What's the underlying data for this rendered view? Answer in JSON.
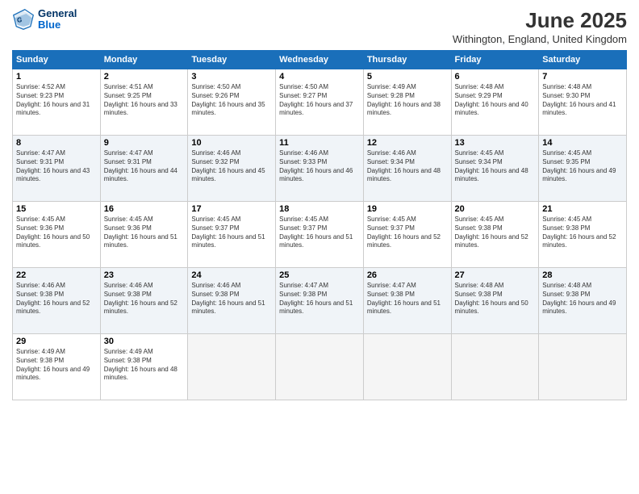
{
  "header": {
    "logo_line1": "General",
    "logo_line2": "Blue",
    "title": "June 2025",
    "subtitle": "Withington, England, United Kingdom"
  },
  "days_of_week": [
    "Sunday",
    "Monday",
    "Tuesday",
    "Wednesday",
    "Thursday",
    "Friday",
    "Saturday"
  ],
  "weeks": [
    [
      {
        "day": 1,
        "sunrise": "Sunrise: 4:52 AM",
        "sunset": "Sunset: 9:23 PM",
        "daylight": "Daylight: 16 hours and 31 minutes."
      },
      {
        "day": 2,
        "sunrise": "Sunrise: 4:51 AM",
        "sunset": "Sunset: 9:25 PM",
        "daylight": "Daylight: 16 hours and 33 minutes."
      },
      {
        "day": 3,
        "sunrise": "Sunrise: 4:50 AM",
        "sunset": "Sunset: 9:26 PM",
        "daylight": "Daylight: 16 hours and 35 minutes."
      },
      {
        "day": 4,
        "sunrise": "Sunrise: 4:50 AM",
        "sunset": "Sunset: 9:27 PM",
        "daylight": "Daylight: 16 hours and 37 minutes."
      },
      {
        "day": 5,
        "sunrise": "Sunrise: 4:49 AM",
        "sunset": "Sunset: 9:28 PM",
        "daylight": "Daylight: 16 hours and 38 minutes."
      },
      {
        "day": 6,
        "sunrise": "Sunrise: 4:48 AM",
        "sunset": "Sunset: 9:29 PM",
        "daylight": "Daylight: 16 hours and 40 minutes."
      },
      {
        "day": 7,
        "sunrise": "Sunrise: 4:48 AM",
        "sunset": "Sunset: 9:30 PM",
        "daylight": "Daylight: 16 hours and 41 minutes."
      }
    ],
    [
      {
        "day": 8,
        "sunrise": "Sunrise: 4:47 AM",
        "sunset": "Sunset: 9:31 PM",
        "daylight": "Daylight: 16 hours and 43 minutes."
      },
      {
        "day": 9,
        "sunrise": "Sunrise: 4:47 AM",
        "sunset": "Sunset: 9:31 PM",
        "daylight": "Daylight: 16 hours and 44 minutes."
      },
      {
        "day": 10,
        "sunrise": "Sunrise: 4:46 AM",
        "sunset": "Sunset: 9:32 PM",
        "daylight": "Daylight: 16 hours and 45 minutes."
      },
      {
        "day": 11,
        "sunrise": "Sunrise: 4:46 AM",
        "sunset": "Sunset: 9:33 PM",
        "daylight": "Daylight: 16 hours and 46 minutes."
      },
      {
        "day": 12,
        "sunrise": "Sunrise: 4:46 AM",
        "sunset": "Sunset: 9:34 PM",
        "daylight": "Daylight: 16 hours and 48 minutes."
      },
      {
        "day": 13,
        "sunrise": "Sunrise: 4:45 AM",
        "sunset": "Sunset: 9:34 PM",
        "daylight": "Daylight: 16 hours and 48 minutes."
      },
      {
        "day": 14,
        "sunrise": "Sunrise: 4:45 AM",
        "sunset": "Sunset: 9:35 PM",
        "daylight": "Daylight: 16 hours and 49 minutes."
      }
    ],
    [
      {
        "day": 15,
        "sunrise": "Sunrise: 4:45 AM",
        "sunset": "Sunset: 9:36 PM",
        "daylight": "Daylight: 16 hours and 50 minutes."
      },
      {
        "day": 16,
        "sunrise": "Sunrise: 4:45 AM",
        "sunset": "Sunset: 9:36 PM",
        "daylight": "Daylight: 16 hours and 51 minutes."
      },
      {
        "day": 17,
        "sunrise": "Sunrise: 4:45 AM",
        "sunset": "Sunset: 9:37 PM",
        "daylight": "Daylight: 16 hours and 51 minutes."
      },
      {
        "day": 18,
        "sunrise": "Sunrise: 4:45 AM",
        "sunset": "Sunset: 9:37 PM",
        "daylight": "Daylight: 16 hours and 51 minutes."
      },
      {
        "day": 19,
        "sunrise": "Sunrise: 4:45 AM",
        "sunset": "Sunset: 9:37 PM",
        "daylight": "Daylight: 16 hours and 52 minutes."
      },
      {
        "day": 20,
        "sunrise": "Sunrise: 4:45 AM",
        "sunset": "Sunset: 9:38 PM",
        "daylight": "Daylight: 16 hours and 52 minutes."
      },
      {
        "day": 21,
        "sunrise": "Sunrise: 4:45 AM",
        "sunset": "Sunset: 9:38 PM",
        "daylight": "Daylight: 16 hours and 52 minutes."
      }
    ],
    [
      {
        "day": 22,
        "sunrise": "Sunrise: 4:46 AM",
        "sunset": "Sunset: 9:38 PM",
        "daylight": "Daylight: 16 hours and 52 minutes."
      },
      {
        "day": 23,
        "sunrise": "Sunrise: 4:46 AM",
        "sunset": "Sunset: 9:38 PM",
        "daylight": "Daylight: 16 hours and 52 minutes."
      },
      {
        "day": 24,
        "sunrise": "Sunrise: 4:46 AM",
        "sunset": "Sunset: 9:38 PM",
        "daylight": "Daylight: 16 hours and 51 minutes."
      },
      {
        "day": 25,
        "sunrise": "Sunrise: 4:47 AM",
        "sunset": "Sunset: 9:38 PM",
        "daylight": "Daylight: 16 hours and 51 minutes."
      },
      {
        "day": 26,
        "sunrise": "Sunrise: 4:47 AM",
        "sunset": "Sunset: 9:38 PM",
        "daylight": "Daylight: 16 hours and 51 minutes."
      },
      {
        "day": 27,
        "sunrise": "Sunrise: 4:48 AM",
        "sunset": "Sunset: 9:38 PM",
        "daylight": "Daylight: 16 hours and 50 minutes."
      },
      {
        "day": 28,
        "sunrise": "Sunrise: 4:48 AM",
        "sunset": "Sunset: 9:38 PM",
        "daylight": "Daylight: 16 hours and 49 minutes."
      }
    ],
    [
      {
        "day": 29,
        "sunrise": "Sunrise: 4:49 AM",
        "sunset": "Sunset: 9:38 PM",
        "daylight": "Daylight: 16 hours and 49 minutes."
      },
      {
        "day": 30,
        "sunrise": "Sunrise: 4:49 AM",
        "sunset": "Sunset: 9:38 PM",
        "daylight": "Daylight: 16 hours and 48 minutes."
      },
      null,
      null,
      null,
      null,
      null
    ]
  ]
}
